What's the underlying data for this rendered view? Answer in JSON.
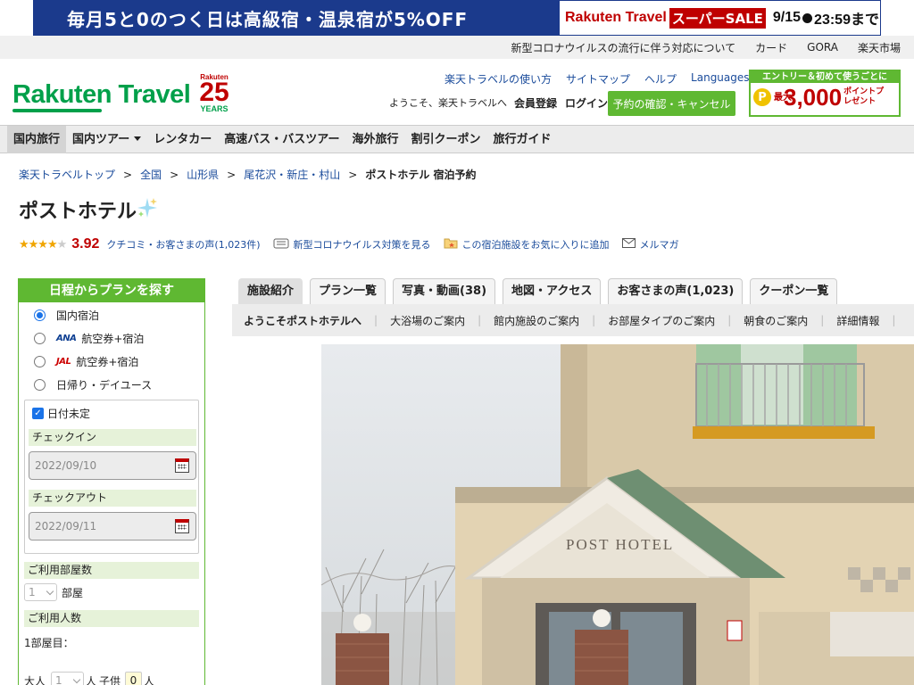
{
  "banner": {
    "left_text": "毎月5と0のつく日は高級宿・温泉宿が5%OFF",
    "brand": "Rakuten Travel",
    "sale_label": "スーパーSALE",
    "date_text": "9/15",
    "time_text": "23:59まで"
  },
  "utility": {
    "links": [
      "新型コロナウイルスの流行に伴う対応について",
      "カード",
      "GORA",
      "楽天市場"
    ]
  },
  "header": {
    "logo_text": "Rakuten Travel",
    "anniv_brand": "Rakuten",
    "anniv_number": "25",
    "anniv_label": "YEARS",
    "nav_links": [
      "楽天トラベルの使い方",
      "サイトマップ",
      "ヘルプ",
      "Languages"
    ],
    "welcome": "ようこそ、楽天トラベルへ",
    "register": "会員登録",
    "login": "ログイン",
    "reserve_button": "予約の確認・キャンセル",
    "promo": {
      "top": "エントリー＆初めて使うごとに",
      "coin": "P",
      "max": "最大",
      "amount": "3,000",
      "unit": "ポイントプレゼント"
    }
  },
  "mainnav": [
    "国内旅行",
    "国内ツアー",
    "レンタカー",
    "高速バス・バスツアー",
    "海外旅行",
    "割引クーポン",
    "旅行ガイド"
  ],
  "breadcrumb": [
    "楽天トラベルトップ",
    "全国",
    "山形県",
    "尾花沢・新庄・村山"
  ],
  "breadcrumb_current": "ポストホテル 宿泊予約",
  "hotel": {
    "name": "ポストホテル",
    "score": "3.92",
    "rating_value": 3.92,
    "reviews_link": "クチコミ・お客さまの声(1,023件)",
    "covid_link": "新型コロナウイルス対策を見る",
    "favorite_link": "この宿泊施設をお気に入りに追加",
    "mail_link": "メルマガ"
  },
  "search": {
    "title": "日程からプランを探す",
    "options": [
      "国内宿泊",
      "航空券+宿泊",
      "航空券+宿泊",
      "日帰り・デイユース"
    ],
    "airlines": [
      "ANA",
      "JAL"
    ],
    "selected_option": "国内宿泊",
    "date_undecided": "日付未定",
    "checkin_label": "チェックイン",
    "checkin_value": "2022/09/10",
    "checkout_label": "チェックアウト",
    "checkout_value": "2022/09/11",
    "rooms_label": "ご利用部屋数",
    "rooms_value": "1",
    "rooms_unit": "部屋",
    "guests_label": "ご利用人数",
    "room1_label": "1部屋目：",
    "adult_label": "大人",
    "adult_value": "1",
    "person_unit": "人",
    "child_label": "子供",
    "child_value": "0"
  },
  "tabs": [
    "施設紹介",
    "プラン一覧",
    "写真・動画(38)",
    "地図・アクセス",
    "お客さまの声(1,023)",
    "クーポン一覧"
  ],
  "subnav": [
    "ようこそポストホテルへ",
    "大浴場のご案内",
    "館内施設のご案内",
    "お部屋タイプのご案内",
    "朝食のご案内",
    "詳細情報"
  ],
  "photo": {
    "sign_text": "POST HOTEL"
  },
  "colors": {
    "brand_green": "#00a04a",
    "accent_green": "#5fb832",
    "rakuten_red": "#bf0000",
    "link_blue": "#1a4b9b",
    "banner_navy": "#1b3a8c"
  }
}
